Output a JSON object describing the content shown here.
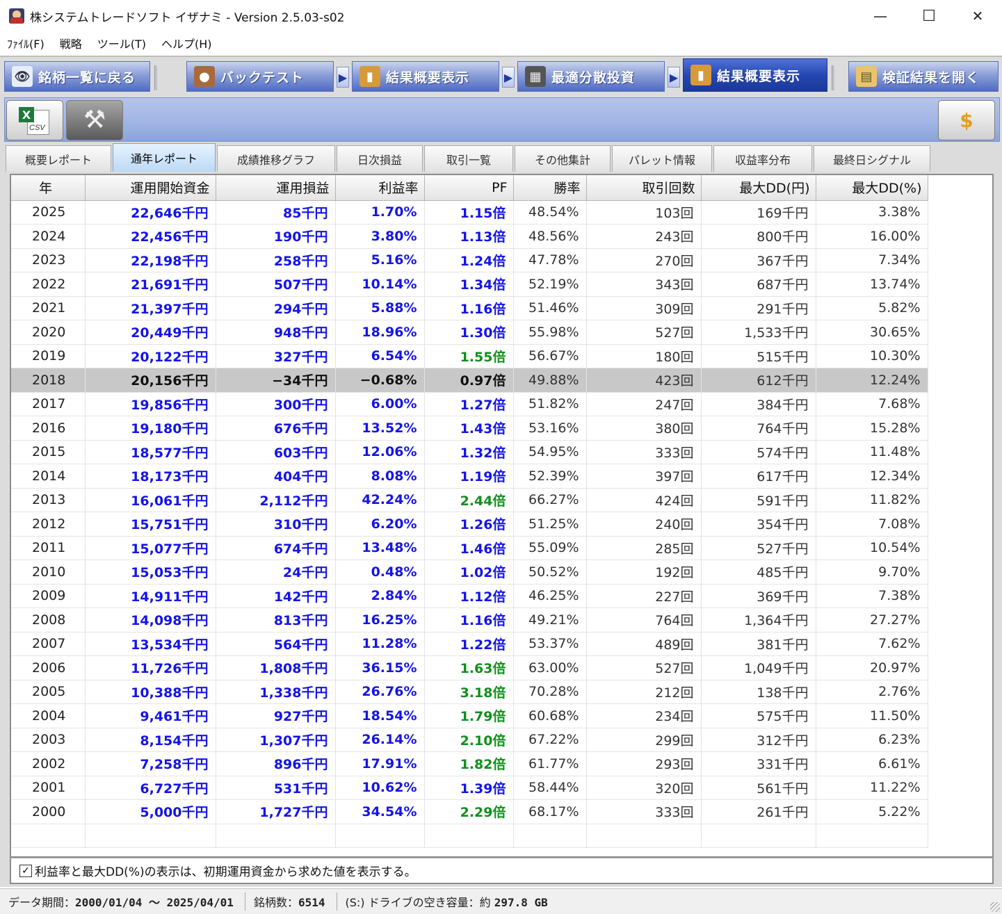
{
  "window": {
    "title": "株システムトレードソフト イザナミ - Version 2.5.03-s02",
    "minimize": "—",
    "maximize": "☐",
    "close": "✕"
  },
  "menu": [
    "ﾌｧｲﾙ(F)",
    "戦略",
    "ツール(T)",
    "ヘルプ(H)"
  ],
  "nav": {
    "back": {
      "label": "銘柄一覧に戻る",
      "icon": "eye-icon"
    },
    "backtest": {
      "label": "バックテスト",
      "icon": "bag-icon"
    },
    "summary1": {
      "label": "結果概要表示",
      "icon": "bar-chart-icon"
    },
    "optimize": {
      "label": "最適分散投資",
      "icon": "grid-icon"
    },
    "summary2": {
      "label": "結果概要表示",
      "icon": "bar-chart-icon"
    },
    "open_result": {
      "label": "検証結果を開く",
      "icon": "folder-icon"
    },
    "arrow": "▶"
  },
  "toolbar": {
    "csv_label": "CSV",
    "excel_glyph": "X",
    "settings_glyph": "⚒",
    "money_glyph": "$"
  },
  "subtabs": [
    "概要レポート",
    "通年レポート",
    "成績推移グラフ",
    "日次損益",
    "取引一覧",
    "その他集計",
    "パレット情報",
    "収益率分布",
    "最終日シグナル"
  ],
  "table": {
    "headers": [
      "年",
      "運用開始資金",
      "運用損益",
      "利益率",
      "PF",
      "勝率",
      "取引回数",
      "最大DD(円)",
      "最大DD(%)"
    ],
    "rows": [
      [
        "2025",
        "22,646千円",
        "85千円",
        "1.70%",
        "1.15倍",
        "48.54%",
        "103回",
        "169千円",
        "3.38%"
      ],
      [
        "2024",
        "22,456千円",
        "190千円",
        "3.80%",
        "1.13倍",
        "48.56%",
        "243回",
        "800千円",
        "16.00%"
      ],
      [
        "2023",
        "22,198千円",
        "258千円",
        "5.16%",
        "1.24倍",
        "47.78%",
        "270回",
        "367千円",
        "7.34%"
      ],
      [
        "2022",
        "21,691千円",
        "507千円",
        "10.14%",
        "1.34倍",
        "52.19%",
        "343回",
        "687千円",
        "13.74%"
      ],
      [
        "2021",
        "21,397千円",
        "294千円",
        "5.88%",
        "1.16倍",
        "51.46%",
        "309回",
        "291千円",
        "5.82%"
      ],
      [
        "2020",
        "20,449千円",
        "948千円",
        "18.96%",
        "1.30倍",
        "55.98%",
        "527回",
        "1,533千円",
        "30.65%"
      ],
      [
        "2019",
        "20,122千円",
        "327千円",
        "6.54%",
        "1.55倍",
        "56.67%",
        "180回",
        "515千円",
        "10.30%"
      ],
      [
        "2018",
        "20,156千円",
        "−34千円",
        "−0.68%",
        "0.97倍",
        "49.88%",
        "423回",
        "612千円",
        "12.24%"
      ],
      [
        "2017",
        "19,856千円",
        "300千円",
        "6.00%",
        "1.27倍",
        "51.82%",
        "247回",
        "384千円",
        "7.68%"
      ],
      [
        "2016",
        "19,180千円",
        "676千円",
        "13.52%",
        "1.43倍",
        "53.16%",
        "380回",
        "764千円",
        "15.28%"
      ],
      [
        "2015",
        "18,577千円",
        "603千円",
        "12.06%",
        "1.32倍",
        "54.95%",
        "333回",
        "574千円",
        "11.48%"
      ],
      [
        "2014",
        "18,173千円",
        "404千円",
        "8.08%",
        "1.19倍",
        "52.39%",
        "397回",
        "617千円",
        "12.34%"
      ],
      [
        "2013",
        "16,061千円",
        "2,112千円",
        "42.24%",
        "2.44倍",
        "66.27%",
        "424回",
        "591千円",
        "11.82%"
      ],
      [
        "2012",
        "15,751千円",
        "310千円",
        "6.20%",
        "1.26倍",
        "51.25%",
        "240回",
        "354千円",
        "7.08%"
      ],
      [
        "2011",
        "15,077千円",
        "674千円",
        "13.48%",
        "1.46倍",
        "55.09%",
        "285回",
        "527千円",
        "10.54%"
      ],
      [
        "2010",
        "15,053千円",
        "24千円",
        "0.48%",
        "1.02倍",
        "50.52%",
        "192回",
        "485千円",
        "9.70%"
      ],
      [
        "2009",
        "14,911千円",
        "142千円",
        "2.84%",
        "1.12倍",
        "46.25%",
        "227回",
        "369千円",
        "7.38%"
      ],
      [
        "2008",
        "14,098千円",
        "813千円",
        "16.25%",
        "1.16倍",
        "49.21%",
        "764回",
        "1,364千円",
        "27.27%"
      ],
      [
        "2007",
        "13,534千円",
        "564千円",
        "11.28%",
        "1.22倍",
        "53.37%",
        "489回",
        "381千円",
        "7.62%"
      ],
      [
        "2006",
        "11,726千円",
        "1,808千円",
        "36.15%",
        "1.63倍",
        "63.00%",
        "527回",
        "1,049千円",
        "20.97%"
      ],
      [
        "2005",
        "10,388千円",
        "1,338千円",
        "26.76%",
        "3.18倍",
        "70.28%",
        "212回",
        "138千円",
        "2.76%"
      ],
      [
        "2004",
        "9,461千円",
        "927千円",
        "18.54%",
        "1.79倍",
        "60.68%",
        "234回",
        "575千円",
        "11.50%"
      ],
      [
        "2003",
        "8,154千円",
        "1,307千円",
        "26.14%",
        "2.10倍",
        "67.22%",
        "299回",
        "312千円",
        "6.23%"
      ],
      [
        "2002",
        "7,258千円",
        "896千円",
        "17.91%",
        "1.82倍",
        "61.77%",
        "293回",
        "331千円",
        "6.61%"
      ],
      [
        "2001",
        "6,727千円",
        "531千円",
        "10.62%",
        "1.39倍",
        "58.44%",
        "320回",
        "561千円",
        "11.22%"
      ],
      [
        "2000",
        "5,000千円",
        "1,727千円",
        "34.54%",
        "2.29倍",
        "68.17%",
        "333回",
        "261千円",
        "5.22%"
      ]
    ],
    "selected_year": "2018"
  },
  "note": {
    "checked": true,
    "check_glyph": "✓",
    "text": "利益率と最大DD(%)の表示は、初期運用資金から求めた値を表示する。"
  },
  "status": {
    "period_label": "データ期間：",
    "period_value": "2000/01/04 〜 2025/04/01",
    "count_label": "銘柄数：",
    "count_value": "6514",
    "drive_label": "(S:) ドライブの空き容量：約",
    "drive_value": "297.8 GB"
  },
  "colors": {
    "value_blue": "#1414e6",
    "pf_green": "#10901a",
    "selected_row": "#c8c8c8",
    "nav_blue": "#4f6cc3",
    "nav_active": "#1a3899"
  }
}
